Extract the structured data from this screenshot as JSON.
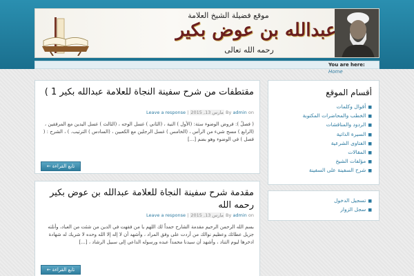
{
  "header": {
    "site_name": "موقع فضيلة الشيخ العلامة",
    "calligraphy": "عبدالله بن عوض بكير",
    "tagline": "رحمه الله تعالى"
  },
  "breadcrumb": {
    "label": "You are here:",
    "home": "Home"
  },
  "posts": [
    {
      "title": "مقتطفات من شرح سفينة النجاة للعلامة عبدالله بكير  1 )",
      "meta_on": "on",
      "meta_date": "مارس 13, 2015",
      "meta_by": "By",
      "meta_author": "admin",
      "meta_sep": "|",
      "meta_response": "Leave a response",
      "excerpt": "( فصلٌ ): فروض الوضوء ستة: (الأول ) النية ، (الثاني ) غسل الوجه ، (الثالث ) غسل اليدين مع المرفقين ، (الرابع ) مسح شيء من الرأس ، (الخامس ) غسل الرجلين مع الكعبين ، (السادس ) الترتيب. ) ، الشرح : ( فصل ) في الوضوء وهو بضم [...]",
      "more_label": "تابع القراءة ←"
    },
    {
      "title": "مقدمة شرح سفينة النجاة للعلامة عبدالله بن عوض بكير رحمه الله",
      "meta_on": "on",
      "meta_date": "مارس 13, 2015",
      "meta_by": "By",
      "meta_author": "admin",
      "meta_sep": "|",
      "meta_response": "Leave a response",
      "excerpt": "بسم الله الرحمن الرحيم مقدمة الشارح حمداً لك اللهم يا من فقهت في الدين من شئت من العباد، وأنلته جزيل عطائك وعظيم نوالك من أردت على وفق المراد ، وأشهد أن لا إله إلا الله وحده لا شريك له شهادة ادخرها ليوم التناد ، وأشهد أن سيدنا محمداً عبده ورسوله الداعي إلى سبيل الرشاد ، [...]",
      "more_label": "تابع القراءة ←"
    }
  ],
  "sidebar": {
    "categories_title": "أقسام الموقع",
    "categories": [
      "أقوال وكلمات",
      "الخطب والمحاضرات المكتوبة",
      "الردود والمناقشات",
      "السيرة الذاتية",
      "الفتاوى الشرعية",
      "المقالات",
      "مؤلفات الشيخ",
      "شرح السفينة على السفينة"
    ],
    "links": [
      "تسجيل الدخول",
      "سجل الزوار"
    ]
  }
}
